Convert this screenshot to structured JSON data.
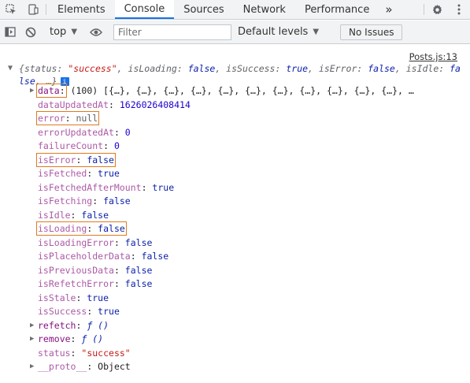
{
  "tabs": {
    "items": [
      {
        "label": "Elements"
      },
      {
        "label": "Console"
      },
      {
        "label": "Sources"
      },
      {
        "label": "Network"
      },
      {
        "label": "Performance"
      }
    ],
    "more": "»"
  },
  "toolbar": {
    "context": "top",
    "filter_placeholder": "Filter",
    "levels": "Default levels",
    "issues": "No Issues"
  },
  "console": {
    "source": "Posts.js:13",
    "summary": {
      "open": "{",
      "k1": "status",
      "v1": "\"success\"",
      "k2": "isLoading",
      "v2": "false",
      "k3": "isSuccess",
      "v3": "true",
      "k4": "isError",
      "v4": "false",
      "k5": "isIdle",
      "v5": "false",
      "tail": "…}"
    },
    "props": [
      {
        "key": "data",
        "value": "(100) [{…}, {…}, {…}, {…}, {…}, {…}, {…}, {…}, {…}, {…}, {…}, …",
        "expand": "▶"
      },
      {
        "key": "dataUpdatedAt",
        "value": "1626026408414"
      },
      {
        "key": "error",
        "value": "null"
      },
      {
        "key": "errorUpdatedAt",
        "value": "0"
      },
      {
        "key": "failureCount",
        "value": "0"
      },
      {
        "key": "isError",
        "value": "false"
      },
      {
        "key": "isFetched",
        "value": "true"
      },
      {
        "key": "isFetchedAfterMount",
        "value": "true"
      },
      {
        "key": "isFetching",
        "value": "false"
      },
      {
        "key": "isIdle",
        "value": "false"
      },
      {
        "key": "isLoading",
        "value": "false"
      },
      {
        "key": "isLoadingError",
        "value": "false"
      },
      {
        "key": "isPlaceholderData",
        "value": "false"
      },
      {
        "key": "isPreviousData",
        "value": "false"
      },
      {
        "key": "isRefetchError",
        "value": "false"
      },
      {
        "key": "isStale",
        "value": "true"
      },
      {
        "key": "isSuccess",
        "value": "true"
      },
      {
        "key": "refetch",
        "value": "ƒ ()",
        "expand": "▶"
      },
      {
        "key": "remove",
        "value": "ƒ ()",
        "expand": "▶"
      },
      {
        "key": "status",
        "value": "\"success\""
      },
      {
        "key": "__proto__",
        "value": "Object",
        "expand": "▶"
      }
    ]
  },
  "colors": {
    "highlight": "#e07a1f",
    "accent": "#1a73e8",
    "key": "#881280",
    "string": "#c41a16",
    "bool": "#0d22aa",
    "number": "#1c00cf"
  }
}
